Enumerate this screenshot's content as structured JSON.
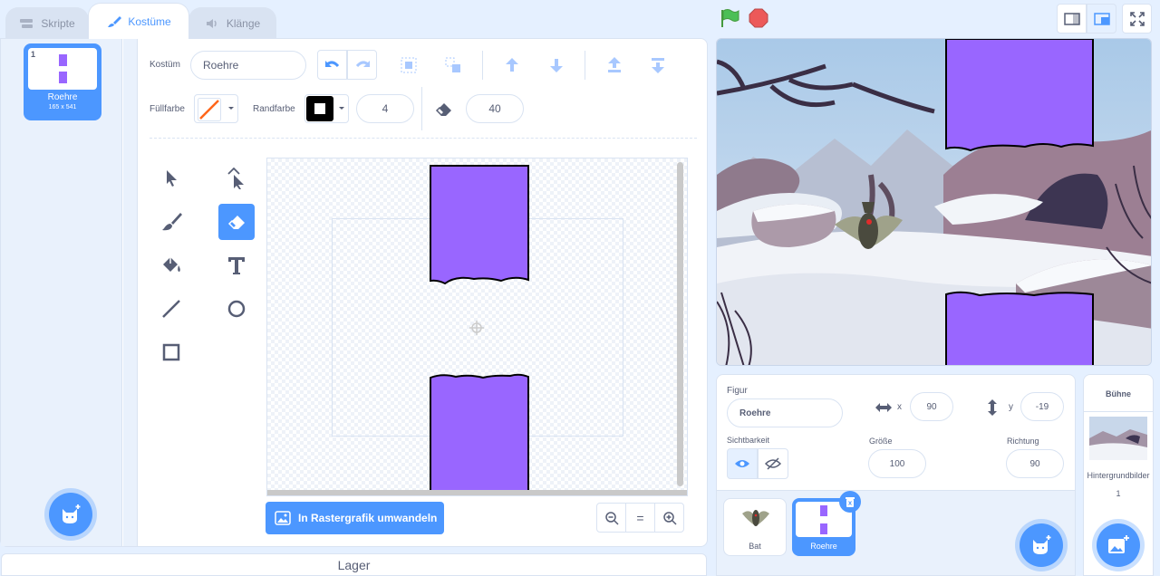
{
  "tabs": [
    {
      "label": "Skripte",
      "icon": "code-blocks-icon"
    },
    {
      "label": "Kostüme",
      "icon": "paintbrush-icon"
    },
    {
      "label": "Klänge",
      "icon": "speaker-icon"
    }
  ],
  "costume_list": {
    "items": [
      {
        "number": "1",
        "name": "Roehre",
        "size": "165 x 541"
      }
    ]
  },
  "toolbar": {
    "costume_label": "Kostüm",
    "costume_name": "Roehre",
    "fill_label": "Füllfarbe",
    "outline_label": "Randfarbe",
    "outline_width": "4",
    "eraser_size": "40"
  },
  "canvas": {
    "convert_label": "In Rastergrafik umwandeln",
    "zoom_reset": "="
  },
  "lager_label": "Lager",
  "sprite_info": {
    "figur_label": "Figur",
    "name": "Roehre",
    "x_label": "x",
    "x_value": "90",
    "y_label": "y",
    "y_value": "-19",
    "visibility_label": "Sichtbarkeit",
    "size_label": "Größe",
    "size_value": "100",
    "direction_label": "Richtung",
    "direction_value": "90"
  },
  "sprites": [
    {
      "name": "Bat"
    },
    {
      "name": "Roehre"
    }
  ],
  "stage_panel": {
    "title": "Bühne",
    "backdrops_label": "Hintergrundbilder",
    "backdrops_count": "1"
  },
  "colors": {
    "accent": "#4c97ff",
    "costume_purple": "#9966ff",
    "green_flag": "#4cbf56",
    "stop": "#ec5959"
  }
}
